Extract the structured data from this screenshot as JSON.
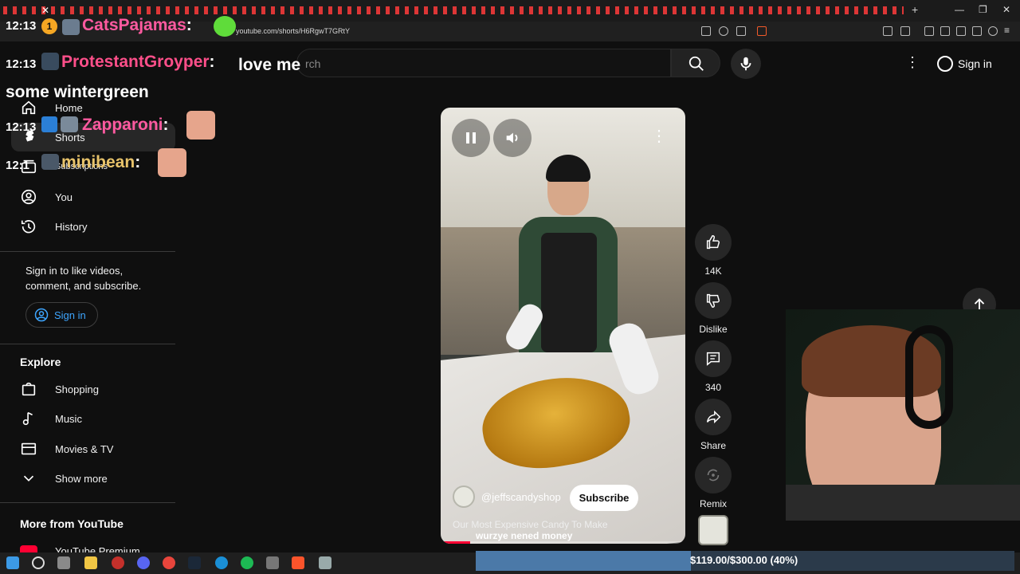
{
  "browser": {
    "url": "youtube.com/shorts/H6RgwT7GRtY"
  },
  "masthead": {
    "search_placeholder": "rch",
    "sign_in": "Sign in"
  },
  "sidebar": {
    "items": [
      {
        "label": "Home",
        "icon": "home-icon"
      },
      {
        "label": "Shorts",
        "icon": "shorts-icon"
      },
      {
        "label": "Subscriptions",
        "icon": "subscriptions-icon"
      },
      {
        "label": "You",
        "icon": "account-icon"
      },
      {
        "label": "History",
        "icon": "history-icon"
      }
    ],
    "signin_prompt": "Sign in to like videos, comment, and subscribe.",
    "signin_button": "Sign in",
    "explore_heading": "Explore",
    "explore": [
      {
        "label": "Shopping",
        "icon": "shopping-bag-icon"
      },
      {
        "label": "Music",
        "icon": "music-note-icon"
      },
      {
        "label": "Movies & TV",
        "icon": "film-icon"
      },
      {
        "label": "Show more",
        "icon": "chevron-down-icon"
      }
    ],
    "more_heading": "More from YouTube",
    "more_items": [
      {
        "label": "YouTube Premium"
      }
    ]
  },
  "chat": [
    {
      "time": "12:13",
      "badge": "1",
      "name": "CatsPajamas",
      "name_color": "#ff5aa0",
      "message": ""
    },
    {
      "time": "12:13",
      "name": "ProtestantGroyper",
      "name_color": "#ff4f8a",
      "message": "love me some wintergreen"
    },
    {
      "time": "12:13",
      "name": "Zapparoni",
      "name_color": "#ff5aa0",
      "message": ""
    },
    {
      "time": "12:1",
      "name": "minibean",
      "name_color": "#e8c36a",
      "message": ""
    }
  ],
  "short": {
    "channel": "@jeffscandyshop",
    "subscribe": "Subscribe",
    "title": "Our Most Expensive Candy To Make",
    "progress": 0.12
  },
  "actions": {
    "like_count": "14K",
    "dislike": "Dislike",
    "comment_count": "340",
    "share": "Share",
    "remix": "Remix"
  },
  "overlay": {
    "caption": "wurzye nened money",
    "donation_text": "$119.00/$300.00 (40%)",
    "donation_fraction": 0.4
  },
  "colors": {
    "accent_link": "#3ea6ff",
    "youtube_red": "#ff0033",
    "background": "#0f0f0f"
  }
}
